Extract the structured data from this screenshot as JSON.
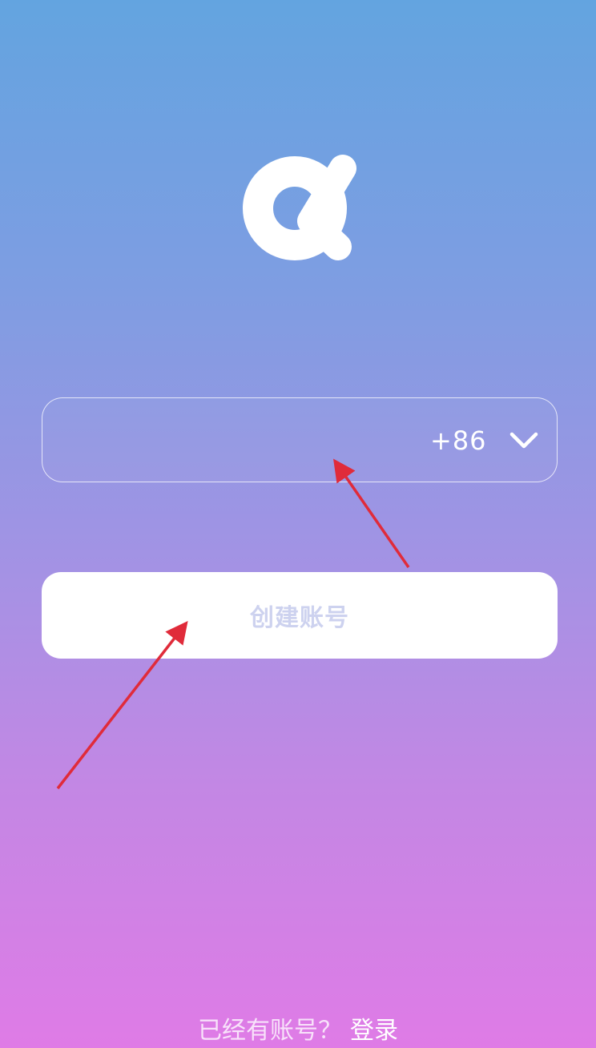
{
  "logo": {
    "icon": "alpha-logo-icon",
    "color": "#ffffff"
  },
  "phone_field": {
    "value": "",
    "country_code": "+86",
    "dropdown_icon": "chevron-down-icon"
  },
  "create_button": {
    "label": "创建账号"
  },
  "footer": {
    "prompt": "已经有账号？",
    "login_label": "登录"
  },
  "theme": {
    "gradient_top": "#63a4e0",
    "gradient_bottom": "#df7be6",
    "button_text_color": "#cdd2ef",
    "annotation_color": "#e02b3a"
  }
}
